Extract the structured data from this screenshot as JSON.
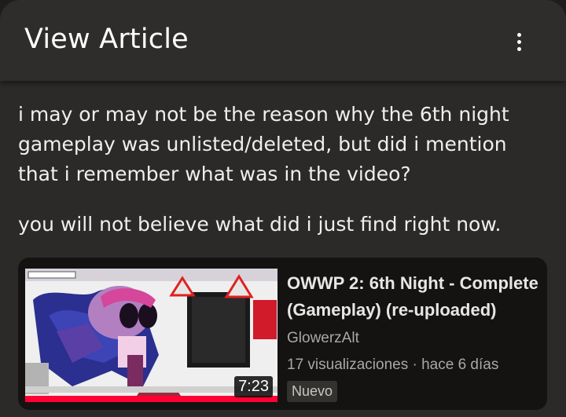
{
  "header": {
    "title": "View Article",
    "menu_icon": "more-vert-icon"
  },
  "article": {
    "paragraphs": [
      "i may or may not be the reason why the 6th night gameplay was unlisted/deleted, but did i mention that i remember what was in the video?",
      "you will not believe what did i just find right now."
    ]
  },
  "video_card": {
    "title": "OWWP 2: 6th Night - Complete (Gameplay) (re-uploaded)",
    "channel": "GlowerzAlt",
    "views": "17 visualizaciones",
    "separator": "·",
    "age": "hace 6 días",
    "duration": "7:23",
    "badge": "Nuevo",
    "progress_color": "#ff0033"
  },
  "colors": {
    "background": "#2c2a28",
    "header": "#2f2d2b",
    "card": "#141312"
  }
}
